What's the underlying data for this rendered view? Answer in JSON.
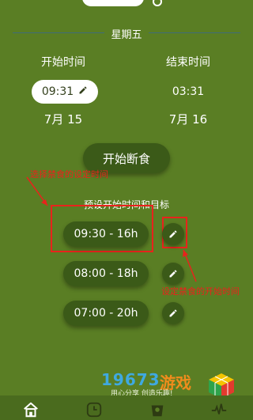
{
  "header": {
    "day": "星期五"
  },
  "start": {
    "label": "开始时间",
    "time": "09:31",
    "date": "7月 15"
  },
  "end": {
    "label": "结束时间",
    "time": "03:31",
    "date": "7月 16"
  },
  "action": {
    "start_fast_label": "开始断食"
  },
  "presets": {
    "title": "预设开始时间和目标",
    "items": [
      {
        "label": "09:30 - 16h"
      },
      {
        "label": "08:00 - 18h"
      },
      {
        "label": "07:00 - 20h"
      }
    ]
  },
  "annotations": {
    "select_preset": "选择禁食的设定时间",
    "set_start": "设定禁食的开始时间"
  },
  "watermark": {
    "number": "19673",
    "game": "游戏",
    "slogan": "用心分享 创造乐趣!"
  },
  "nav": {
    "items": [
      "home-icon",
      "clock-icon",
      "scale-icon",
      "pulse-icon"
    ]
  },
  "colors": {
    "background": "#5a7e24",
    "button": "#3b5a18",
    "annotation_red": "#e8231c"
  }
}
